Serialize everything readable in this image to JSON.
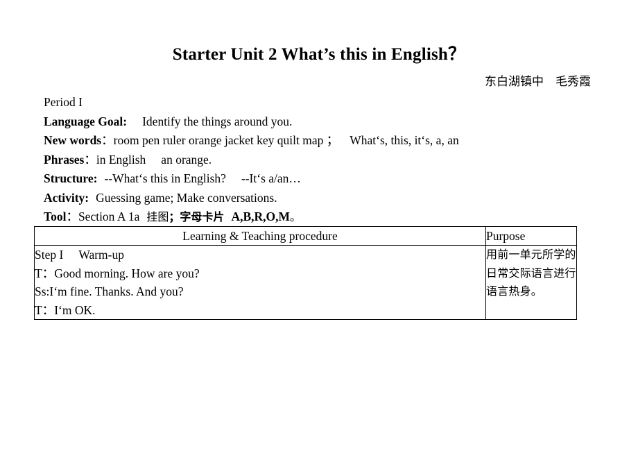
{
  "document": {
    "title": "Starter Unit 2 What’s this in English？",
    "author_line": "东白湖镇中　毛秀霞",
    "period": "Period I",
    "lines": [
      {
        "label": "Language Goal:",
        "text": "Identify the things around you."
      },
      {
        "label": "New words",
        "separator": "：",
        "text": "room pen ruler orange jacket key quilt map ；",
        "text2": "What‘s, this, it‘s, a, an"
      },
      {
        "label": "Phrases",
        "separator": "：",
        "text": "in English",
        "text2": "an orange."
      },
      {
        "label": "Structure:",
        "text": "--What‘s this in English?",
        "text2": "--It‘s a/an…"
      },
      {
        "label": "Activity:",
        "text": "Guessing game; Make conversations."
      },
      {
        "label": "Tool",
        "separator": "：",
        "text": "Section A 1a",
        "cjk_plain": "挂图",
        "cjk_bold": "；字母卡片",
        "bold_tail": "A,B,R,O,M",
        "cjk_end": "。"
      }
    ]
  },
  "table": {
    "headers": {
      "procedure": "Learning & Teaching procedure",
      "purpose": "Purpose"
    },
    "rows": [
      {
        "procedure_lines": [
          {
            "speaker": "Step I",
            "text": "Warm-up"
          },
          {
            "speaker": "T：",
            "text": "Good morning. How are you?"
          },
          {
            "speaker": "Ss:",
            "text": "I‘m fine. Thanks. And you?"
          },
          {
            "speaker": "T：",
            "text": "I‘m OK."
          }
        ],
        "purpose": "用前一单元所学的日常交际语言进行语言热身。"
      }
    ]
  }
}
